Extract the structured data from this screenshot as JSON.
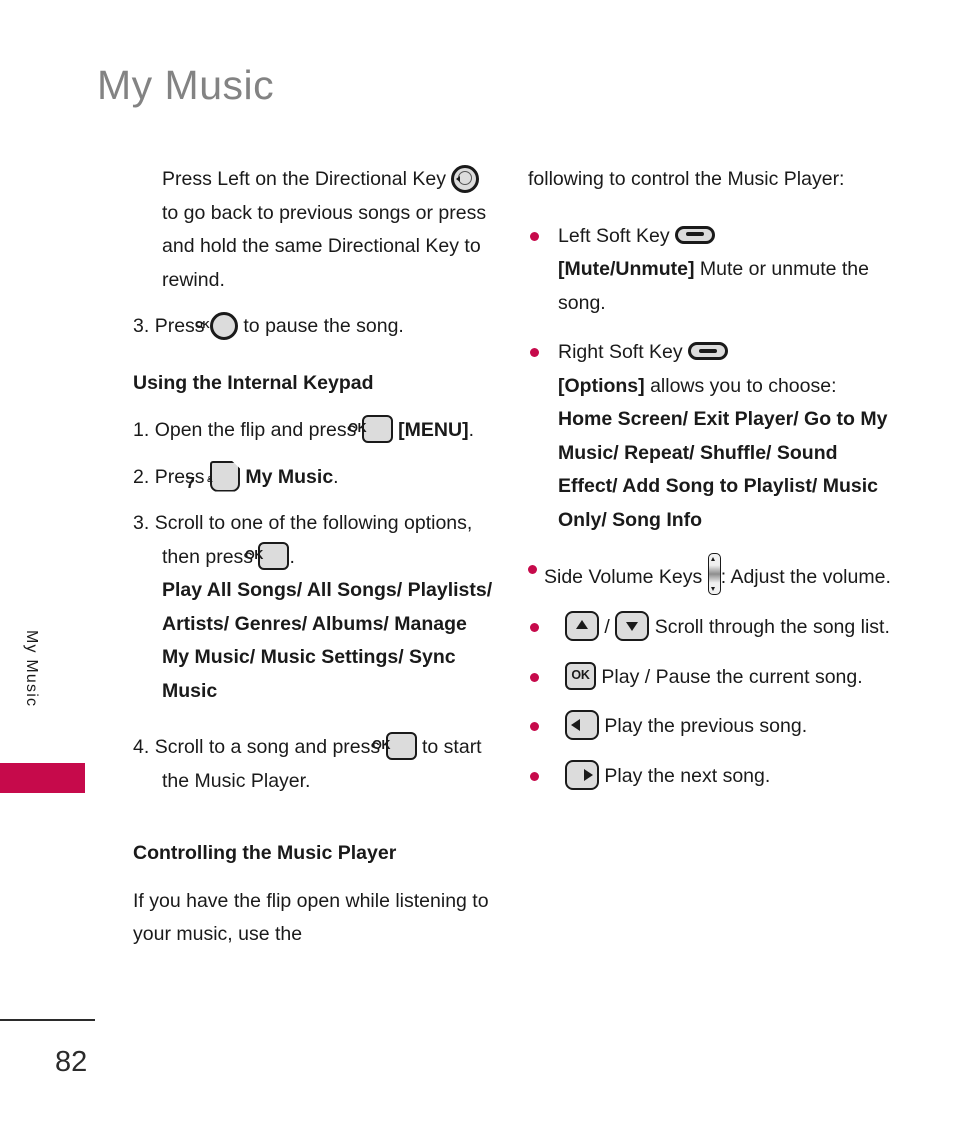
{
  "document": {
    "title": "My Music",
    "side_tab_label": "My Music",
    "page_number": "82",
    "accent_color": "#C60A4B",
    "title_color": "#838383"
  },
  "left_column": {
    "continued_paragraph": {
      "part1": "Press Left on the Directional Key",
      "icon": "directional-key-left-icon",
      "part2": "to go back to previous songs or press and hold the same Directional Key to rewind."
    },
    "step3_pause": {
      "number": "3.",
      "part1": "Press",
      "icon": "ok-circle-key-icon",
      "part2": "to pause the song."
    },
    "heading_internal_keypad": "Using the Internal Keypad",
    "step1": {
      "number": "1.",
      "part1": "Open the flip and press",
      "icon": "ok-square-key-icon",
      "part2_bold": "[MENU]",
      "part3": "."
    },
    "step2": {
      "number": "2.",
      "part1": "Press",
      "icon": "number-7-key-icon",
      "key_digit": "7",
      "key_superscript": "&",
      "part2_bold": "My Music",
      "part3": "."
    },
    "step3_scroll": {
      "number": "3.",
      "part1": "Scroll to one of the following options, then press",
      "icon": "ok-square-key-icon",
      "part2": ".",
      "options_bold": "Play All Songs/ All Songs/ Playlists/ Artists/ Genres/ Albums/ Manage My Music/ Music Settings/ Sync Music"
    },
    "step4": {
      "number": "4.",
      "part1": "Scroll to a song and press",
      "icon": "ok-square-key-icon",
      "part2": "to start the Music Player."
    },
    "heading_controlling": "Controlling the Music Player",
    "closing_paragraph": "If you have the flip open while listening to your music, use the"
  },
  "right_column": {
    "continued_paragraph": "following to control the Music Player:",
    "bullets": [
      {
        "id": "left-soft-key",
        "label": "Left Soft Key",
        "icon": "soft-key-icon",
        "bracket_bold": "[Mute/Unmute]",
        "description": " Mute or unmute the song."
      },
      {
        "id": "right-soft-key",
        "label": "Right Soft Key",
        "icon": "soft-key-icon",
        "bracket_bold": "[Options]",
        "description": " allows you to choose:",
        "options_bold": "Home Screen/ Exit Player/ Go to My Music/ Repeat/ Shuffle/ Sound Effect/ Add Song to Playlist/ Music Only/ Song Info"
      },
      {
        "id": "side-volume-keys",
        "label": "Side Volume Keys",
        "icon": "side-volume-rocker-icon",
        "description": ": Adjust the volume."
      },
      {
        "id": "scroll-keys",
        "icon_up": "arrow-up-key-icon",
        "separator": "/",
        "icon_down": "arrow-down-key-icon",
        "description": "Scroll through the song list."
      },
      {
        "id": "play-pause-key",
        "icon": "ok-square-key-icon",
        "description": "Play / Pause the current song."
      },
      {
        "id": "previous-song-key",
        "icon": "arrow-left-key-icon",
        "description": "Play the previous song."
      },
      {
        "id": "next-song-key",
        "icon": "arrow-right-key-icon",
        "description": "Play the next song."
      }
    ]
  }
}
